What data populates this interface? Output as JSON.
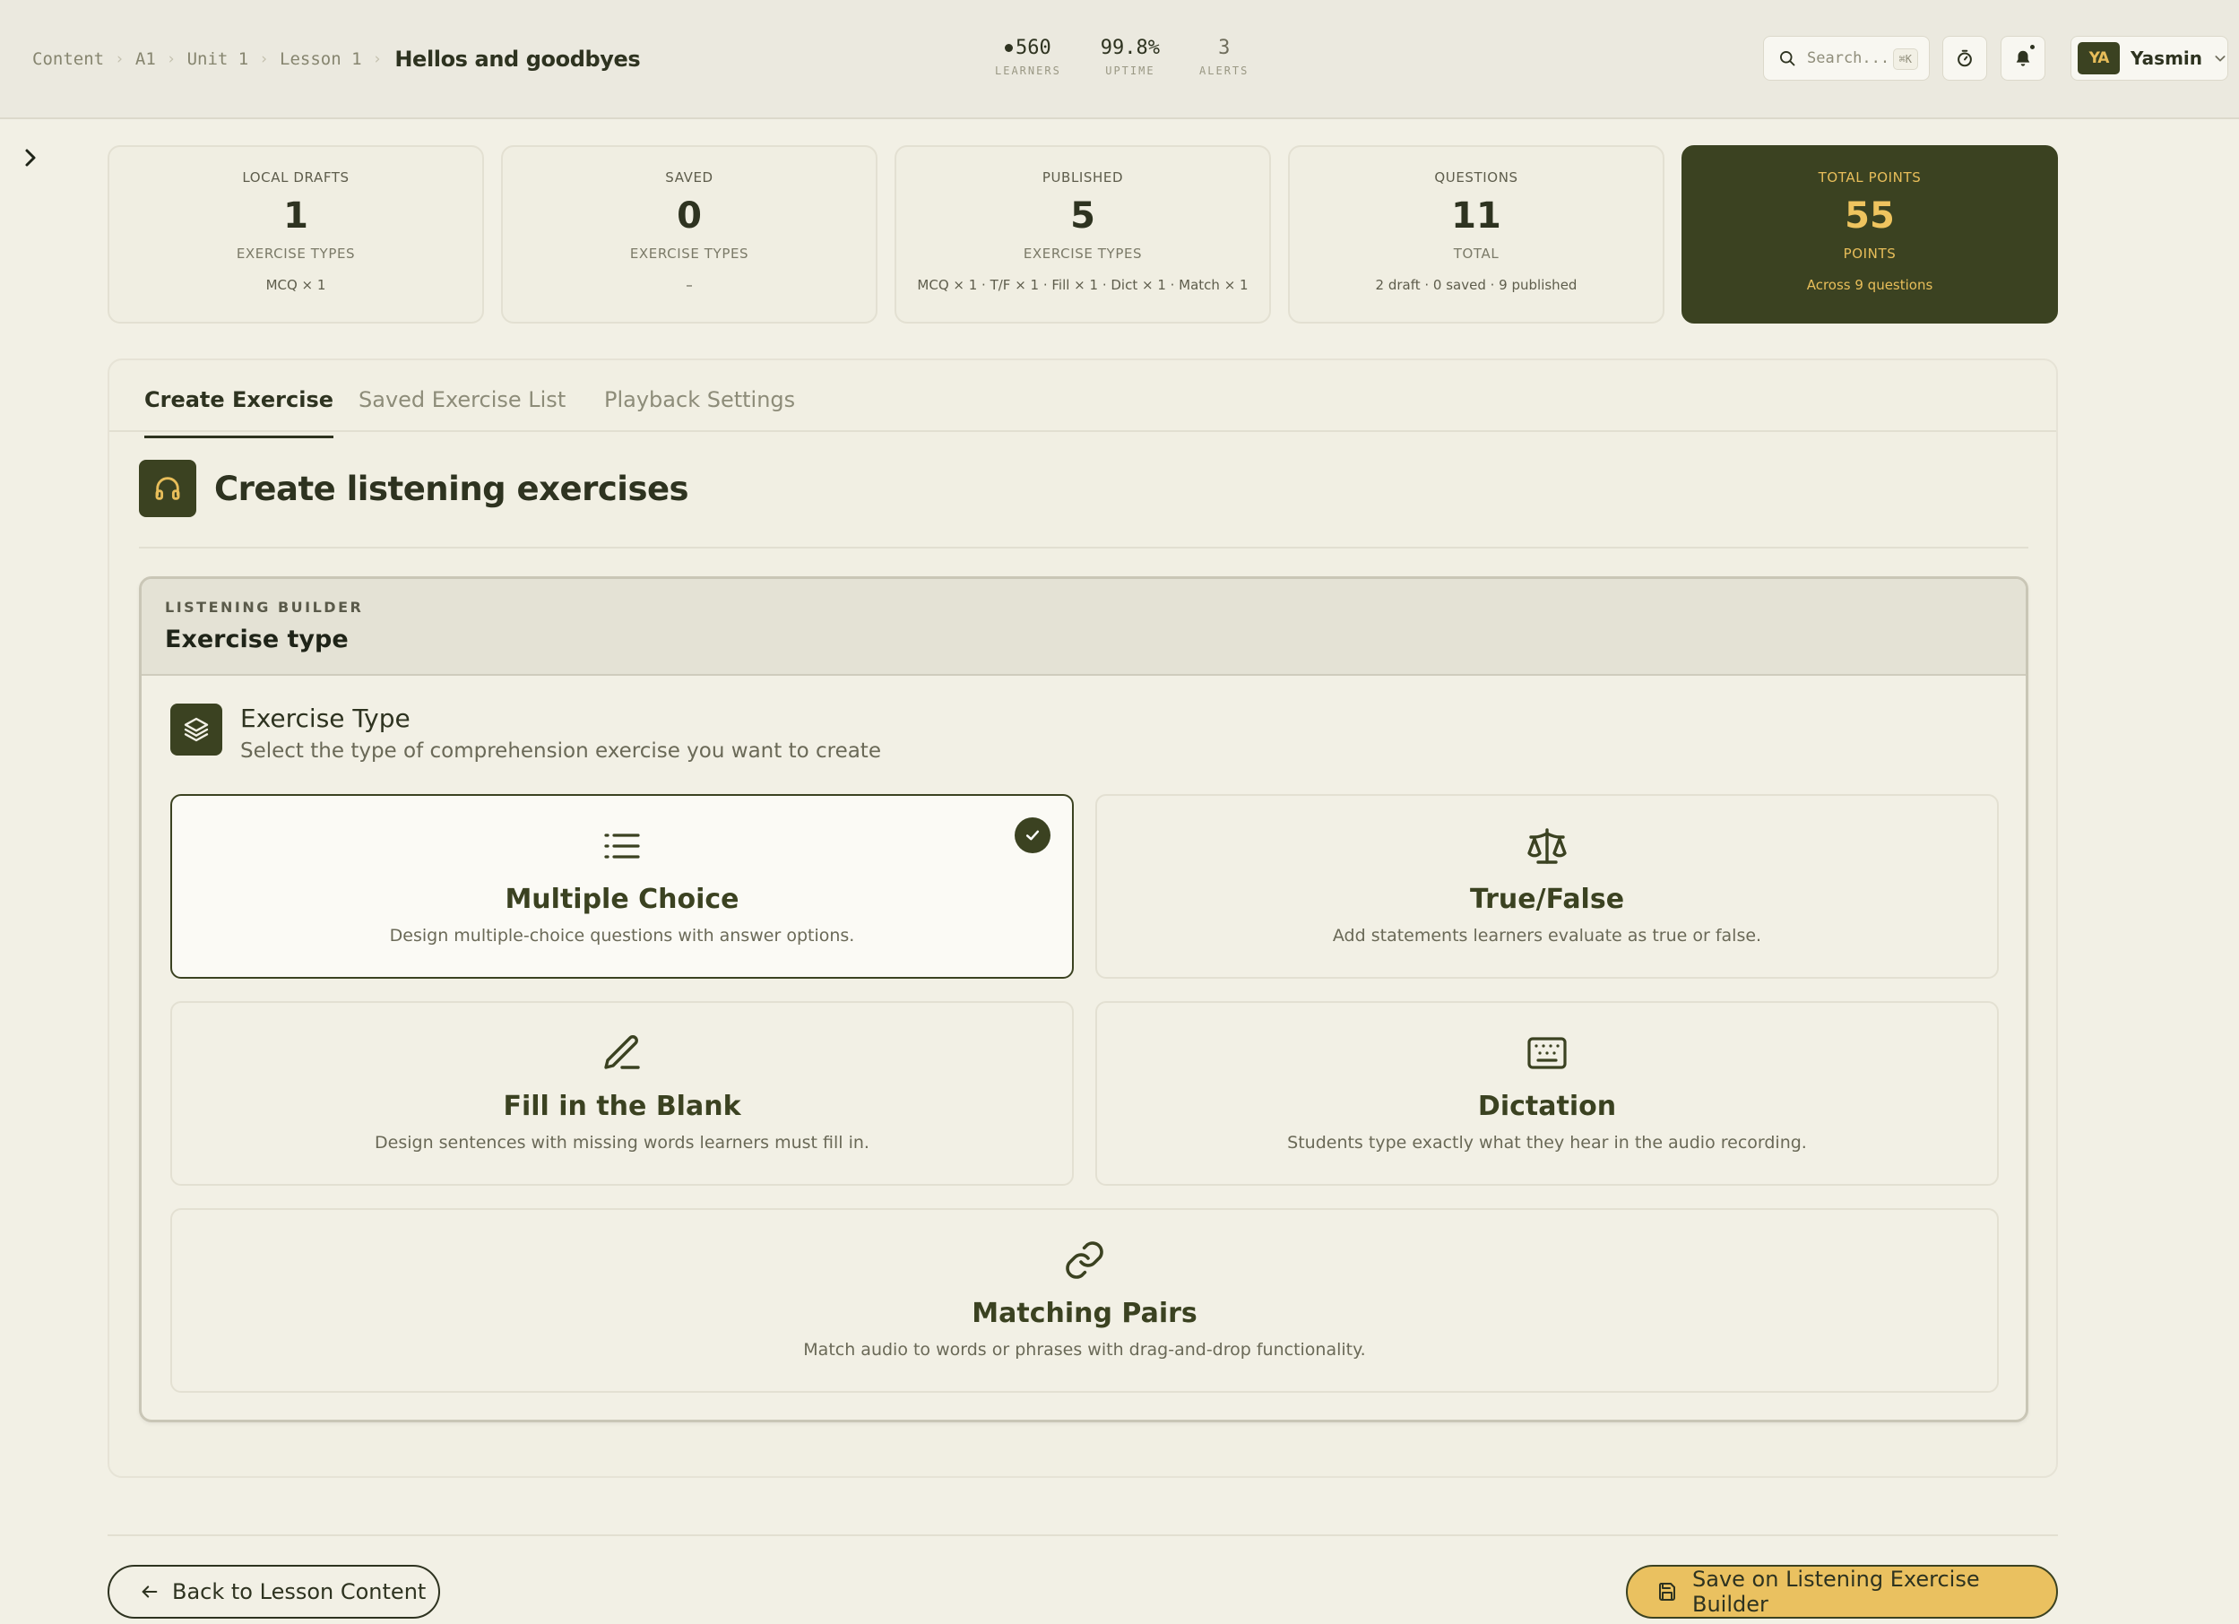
{
  "header": {
    "breadcrumb": [
      "Content",
      "A1",
      "Unit 1",
      "Lesson 1"
    ],
    "current_page": "Hellos and goodbyes",
    "metrics": [
      {
        "value": "560",
        "label": "LEARNERS",
        "live": true
      },
      {
        "value": "99.8%",
        "label": "UPTIME",
        "live": false
      },
      {
        "value": "3",
        "label": "ALERTS",
        "live": false
      }
    ],
    "search_placeholder": "Search...",
    "search_shortcut": "⌘K",
    "user": {
      "initials": "YA",
      "name": "Yasmin"
    }
  },
  "stats": [
    {
      "label": "LOCAL DRAFTS",
      "value": "1",
      "sub": "EXERCISE TYPES",
      "detail": "MCQ × 1"
    },
    {
      "label": "SAVED",
      "value": "0",
      "sub": "EXERCISE TYPES",
      "detail": "–"
    },
    {
      "label": "PUBLISHED",
      "value": "5",
      "sub": "EXERCISE TYPES",
      "detail": "MCQ × 1 · T/F × 1 · Fill × 1 · Dict × 1 · Match × 1"
    },
    {
      "label": "QUESTIONS",
      "value": "11",
      "sub": "TOTAL",
      "detail": "2 draft · 0 saved · 9 published"
    },
    {
      "label": "TOTAL POINTS",
      "value": "55",
      "sub": "POINTS",
      "detail": "Across 9 questions"
    }
  ],
  "tabs": [
    "Create Exercise",
    "Saved Exercise List",
    "Playback Settings"
  ],
  "active_tab": "Create Exercise",
  "section_title": "Create listening exercises",
  "builder": {
    "eyebrow": "LISTENING BUILDER",
    "title": "Exercise type",
    "type_title": "Exercise Type",
    "type_description": "Select the type of comprehension exercise you want to create",
    "options": [
      {
        "title": "Multiple Choice",
        "description": "Design multiple-choice questions with answer options.",
        "icon": "list-icon",
        "selected": true
      },
      {
        "title": "True/False",
        "description": "Add statements learners evaluate as true or false.",
        "icon": "scale-icon",
        "selected": false
      },
      {
        "title": "Fill in the Blank",
        "description": "Design sentences with missing words learners must fill in.",
        "icon": "pencil-icon",
        "selected": false
      },
      {
        "title": "Dictation",
        "description": "Students type exactly what they hear in the audio recording.",
        "icon": "keyboard-icon",
        "selected": false
      },
      {
        "title": "Matching Pairs",
        "description": "Match audio to words or phrases with drag-and-drop functionality.",
        "icon": "link-icon",
        "selected": false
      }
    ]
  },
  "footer": {
    "back_label": "Back to Lesson Content",
    "save_label": "Save on Listening Exercise Builder"
  },
  "colors": {
    "background": "#f2f0e5",
    "primary_dark": "#3b4221",
    "accent_gold": "#eac160",
    "text": "#2e3320"
  }
}
